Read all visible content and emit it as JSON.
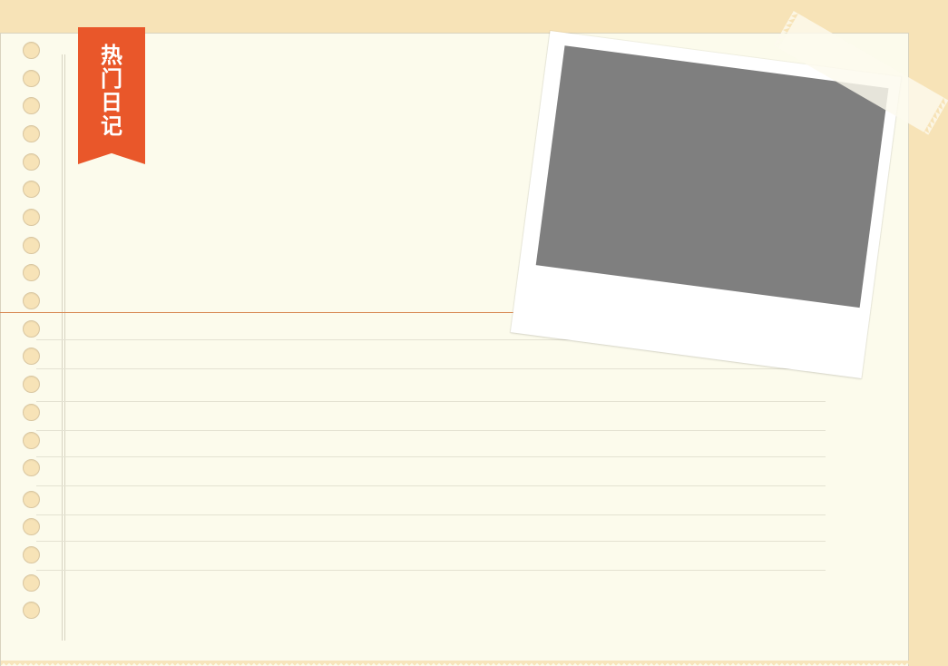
{
  "ribbon": {
    "label": "热门日记"
  },
  "colors": {
    "background": "#f7e3b7",
    "paper": "#fcfbec",
    "ribbon": "#e9572a",
    "photo_placeholder": "#7f7f7f",
    "accent_rule": "#d7854e"
  },
  "icons": {
    "binder_holes": "binder-hole-icon",
    "tape": "tape-icon"
  }
}
